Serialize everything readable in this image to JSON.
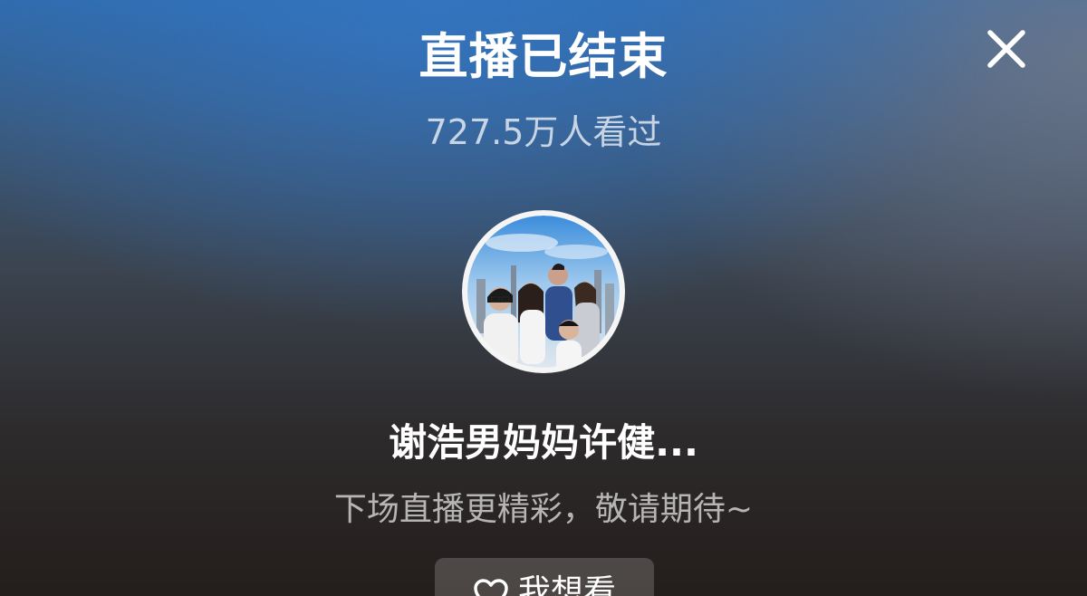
{
  "header": {
    "title": "直播已结束",
    "viewers": "727.5万人看过",
    "close_icon": "close-icon"
  },
  "streamer": {
    "avatar_icon": "family-photo-avatar",
    "name": "谢浩男妈妈许健...",
    "message": "下场直播更精彩，敬请期待~"
  },
  "actions": {
    "want_label": "我想看",
    "want_icon": "heart-icon"
  },
  "colors": {
    "text_primary": "#ffffff",
    "background_top": "#2f6aa9",
    "background_bottom": "#241e1c",
    "button_bg": "rgba(255,255,255,0.18)"
  }
}
